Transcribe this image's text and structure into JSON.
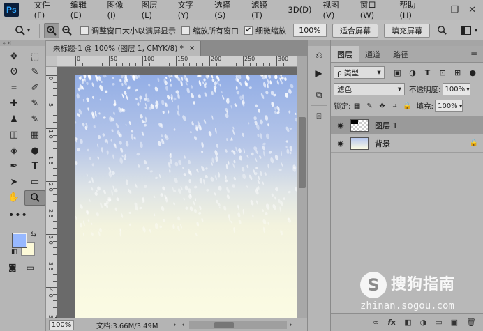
{
  "app": {
    "logo": "Ps"
  },
  "menu": [
    "文件(F)",
    "编辑(E)",
    "图像(I)",
    "图层(L)",
    "文字(Y)",
    "选择(S)",
    "滤镜(T)",
    "3D(D)",
    "视图(V)",
    "窗口(W)",
    "帮助(H)"
  ],
  "window_buttons": {
    "minimize": "—",
    "restore": "❐",
    "close": "✕"
  },
  "options": {
    "zoom_icon": "zoom-icon",
    "chk_resize": "调整窗口大小以满屏显示",
    "chk_zoom_all": "缩放所有窗口",
    "chk_scrubby": "细微缩放",
    "zoom_value": "100%",
    "fit_screen": "适合屏幕",
    "fill_screen": "填充屏幕"
  },
  "toolbar": {
    "tools": [
      "✥",
      "⬚",
      "ʘ",
      "✎",
      "⌗",
      "✐",
      "✚",
      "✎",
      "♟",
      "✎",
      "◫",
      "▦",
      "◈",
      "●",
      "✒",
      "T",
      "➤",
      "▭",
      "✋",
      "🔍"
    ],
    "more": "•••",
    "swap": "⇆",
    "mini": "◧",
    "foreground_color": "#97b8ff",
    "background_color": "#fdfad8"
  },
  "document": {
    "tab_title": "未标题-1 @ 100% (图层 1, CMYK/8) *",
    "tab_close": "×",
    "ruler_h_labels": [
      "0",
      "50",
      "100",
      "150",
      "200",
      "250",
      "300",
      "350"
    ],
    "ruler_v_labels": [
      "0",
      "5",
      "1 0",
      "1 5",
      "2 0",
      "2 5",
      "3 0",
      "3 5",
      "4 0",
      "4 5"
    ],
    "zoom": "100%",
    "doc_size": "文档:3.66M/3.49M",
    "status_arrow": "›",
    "scroll_left": "‹",
    "scroll_right": "›"
  },
  "layers_panel": {
    "tabs": [
      "图层",
      "通道",
      "路径"
    ],
    "menu_icon": "≡",
    "filter_label": "ρ 类型",
    "blend_mode": "滤色",
    "opacity_label": "不透明度:",
    "opacity": "100%",
    "lock_label": "锁定:",
    "fill_label": "填充:",
    "fill": "100%",
    "layers": [
      {
        "name": "图层 1",
        "thumb": "transparent",
        "selected": true
      },
      {
        "name": "背景",
        "thumb": "gradient",
        "locked": true
      }
    ],
    "bottom_icons": [
      "∞",
      "fx",
      "◧",
      "◑",
      "▭",
      "▣",
      "🗑"
    ]
  },
  "watermark": {
    "logo": "S",
    "cn": "搜狗指南",
    "url": "zhinan.sogou.com"
  }
}
